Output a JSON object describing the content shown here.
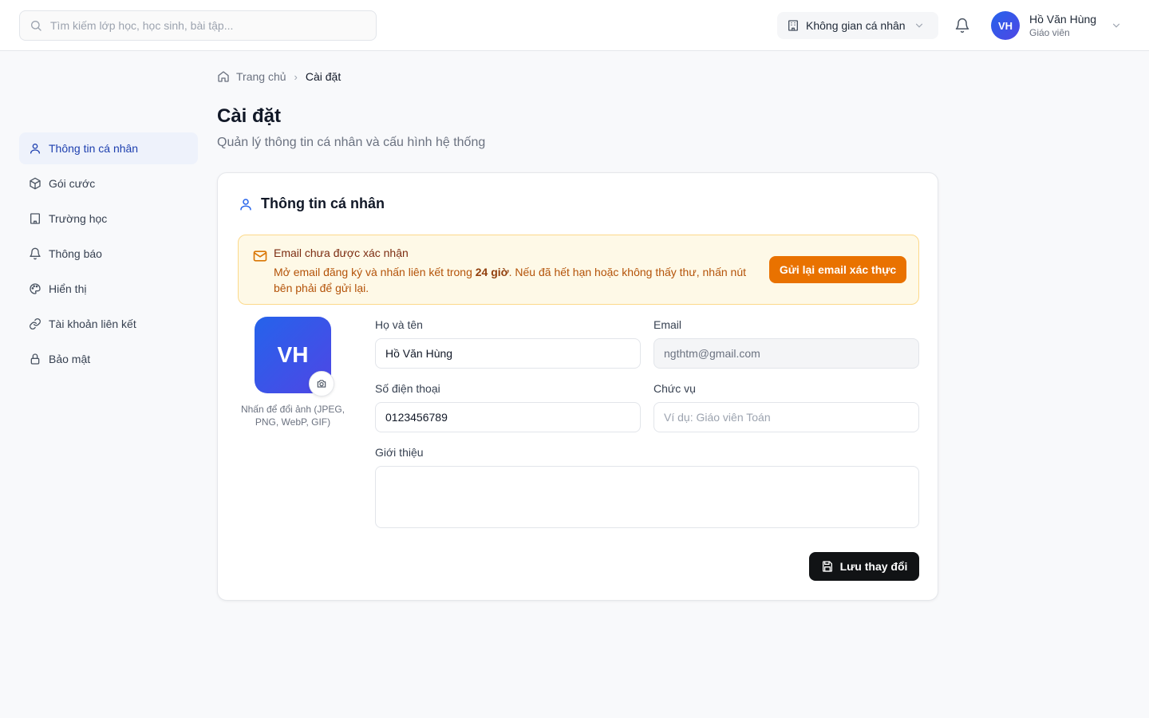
{
  "topbar": {
    "search_placeholder": "Tìm kiếm lớp học, học sinh, bài tập...",
    "workspace_label": "Không gian cá nhân",
    "user": {
      "initials": "VH",
      "name": "Hồ Văn Hùng",
      "role": "Giáo viên"
    }
  },
  "sidebar": {
    "items": [
      {
        "label": "Thông tin cá nhân",
        "icon": "user-icon",
        "active": true
      },
      {
        "label": "Gói cước",
        "icon": "package-icon"
      },
      {
        "label": "Trường học",
        "icon": "school-icon"
      },
      {
        "label": "Thông báo",
        "icon": "bell-icon"
      },
      {
        "label": "Hiển thị",
        "icon": "palette-icon"
      },
      {
        "label": "Tài khoản liên kết",
        "icon": "link-icon"
      },
      {
        "label": "Bảo mật",
        "icon": "lock-icon"
      }
    ]
  },
  "breadcrumb": {
    "home": "Trang chủ",
    "current": "Cài đặt"
  },
  "page": {
    "title": "Cài đặt",
    "subtitle": "Quản lý thông tin cá nhân và cấu hình hệ thống"
  },
  "card": {
    "title": "Thông tin cá nhân",
    "alert": {
      "title": "Email chưa được xác nhận",
      "message_before": "Mở email đăng ký và nhấn liên kết trong ",
      "message_bold": "24 giờ",
      "message_after": ". Nếu đã hết hạn hoặc không thấy thư, nhấn nút bên phải để gửi lại.",
      "button": "Gửi lại email xác thực"
    },
    "avatar": {
      "initials": "VH",
      "hint": "Nhấn để đổi ảnh (JPEG, PNG, WebP, GIF)"
    },
    "fields": {
      "fullname": {
        "label": "Họ và tên",
        "value": "Hồ Văn Hùng"
      },
      "email": {
        "label": "Email",
        "value": "ngthtm@gmail.com"
      },
      "phone": {
        "label": "Số điện thoại",
        "value": "0123456789"
      },
      "position": {
        "label": "Chức vụ",
        "value": "",
        "placeholder": "Ví dụ: Giáo viên Toán"
      },
      "bio": {
        "label": "Giới thiệu",
        "value": ""
      }
    },
    "save_button": "Lưu thay đổi"
  },
  "colors": {
    "accent": "#1e40af",
    "avatar_gradient_start": "#2563eb",
    "avatar_gradient_end": "#4f46e5",
    "warning_bg": "#fef9e7",
    "warning_button": "#e97200",
    "save_button": "#111315"
  }
}
